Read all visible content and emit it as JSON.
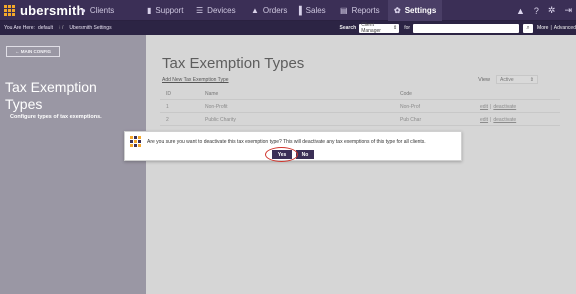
{
  "brand": {
    "name": "ubersmith"
  },
  "nav": {
    "items": [
      {
        "label": "Clients",
        "icon": "user-icon"
      },
      {
        "label": "Support",
        "icon": "support-icon"
      },
      {
        "label": "Devices",
        "icon": "devices-icon"
      },
      {
        "label": "Orders",
        "icon": "orders-icon"
      },
      {
        "label": "Sales",
        "icon": "sales-icon"
      },
      {
        "label": "Reports",
        "icon": "reports-icon"
      },
      {
        "label": "Settings",
        "icon": "settings-icon"
      }
    ]
  },
  "breadcrumb": {
    "prefix": "You Are Here:",
    "current": "default",
    "location": "Ubersmith Settings"
  },
  "search": {
    "label": "Search",
    "type": "Client Manager",
    "for_label": "for",
    "more": "More",
    "advanced": "Advanced"
  },
  "sidebar": {
    "main_config": "← MAIN CONFIG",
    "title": "Tax Exemption Types",
    "description": "Configure types of tax exemptions."
  },
  "main": {
    "title": "Tax Exemption Types",
    "add_link": "Add New Tax Exemption Type",
    "view_label": "View",
    "view_value": "Active",
    "columns": [
      "ID",
      "Name",
      "Code"
    ],
    "rows": [
      {
        "id": "1",
        "name": "Non-Profit",
        "code": "Non-Prof"
      },
      {
        "id": "2",
        "name": "Public Charity",
        "code": "Pub Char"
      }
    ],
    "action_edit": "edit",
    "action_deactivate": "deactivate"
  },
  "modal": {
    "message": "Are you sure you want to deactivate this tax exemption type? This will deactivate any tax exemptions of this type for all clients.",
    "yes": "Yes",
    "no": "No"
  },
  "colors": {
    "nav_bg": "#3b2f56",
    "accent": "#f4a82b",
    "highlight_ring": "#d0342c"
  }
}
